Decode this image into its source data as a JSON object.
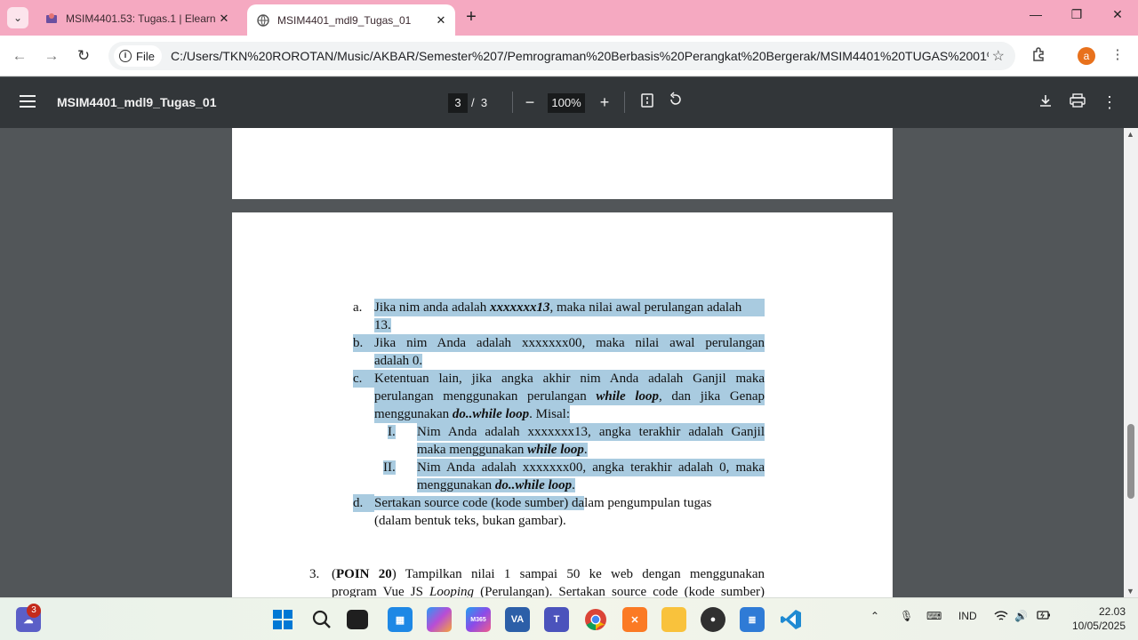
{
  "browser": {
    "tabs": [
      {
        "title": "MSIM4401.53: Tugas.1 | Elearni",
        "active": false
      },
      {
        "title": "MSIM4401_mdl9_Tugas_01",
        "active": true
      }
    ],
    "address": {
      "chip_label": "File",
      "url": "C:/Users/TKN%20ROROTAN/Music/AKBAR/Semester%207/Pemrograman%20Berbasis%20Perangkat%20Bergerak/MSIM4401%20TUGAS%2001%2..."
    },
    "profile_initial": "a"
  },
  "pdf_toolbar": {
    "title": "MSIM4401_mdl9_Tugas_01",
    "current_page": "3",
    "page_separator": "/",
    "total_pages": "3",
    "zoom": "100%"
  },
  "document": {
    "items": {
      "a_marker": "a.",
      "a_l1_pre": "Jika nim anda adalah ",
      "a_l1_em": "xxxxxxx13",
      "a_l1_post": ", maka nilai awal perulangan adalah",
      "a_l2": "13.",
      "b_marker": "b.",
      "b_l1": "Jika nim Anda adalah xxxxxxx00, maka nilai awal perulangan",
      "b_l2": "adalah 0.",
      "c_marker": "c.",
      "c_l1": "Ketentuan lain, jika angka akhir nim Anda adalah Ganjil maka",
      "c_l2_pre": "perulangan menggunakan perulangan ",
      "c_l2_em": "while loop",
      "c_l2_post": ", dan jika Genap",
      "c_l3_pre": "menggunakan ",
      "c_l3_em": "do..while loop",
      "c_l3_post": ". Misal:",
      "i_marker": "I.",
      "i_l1": "Nim Anda adalah xxxxxxx13, angka terakhir adalah Ganjil",
      "i_l2_pre": "maka menggunakan ",
      "i_l2_em": "while loop",
      "i_l2_post": ".",
      "ii_marker": "II.",
      "ii_l1": "Nim Anda adalah xxxxxxx00, angka terakhir adalah 0, maka",
      "ii_l2_pre": "menggunakan ",
      "ii_l2_em": "do..while loop",
      "ii_l2_post": ".",
      "d_marker": "d.",
      "d_l1_hl": "Sertakan source code (kode sumber) da",
      "d_l1_rest": "lam pengumpulan tugas",
      "d_l2": "(dalam bentuk teks, bukan gambar).",
      "n3_marker": "3.",
      "n3_l1_open": "(",
      "n3_l1_bold": "POIN 20",
      "n3_l1_rest": ") Tampilkan nilai 1 sampai 50 ke web dengan menggunakan",
      "n3_l2_pre": "program Vue JS ",
      "n3_l2_em": "Looping",
      "n3_l2_post": " (Perulangan). Sertakan source code (kode sumber)"
    }
  },
  "taskbar": {
    "notification_count": "3",
    "apps": [
      "widgets",
      "start",
      "search",
      "file-explorer-dark",
      "microsoft-store",
      "copilot",
      "m365",
      "visual-studio",
      "teams",
      "chrome",
      "xampp",
      "file-explorer",
      "obs",
      "notepad",
      "vscode"
    ],
    "language": "IND",
    "time": "22.03",
    "date": "10/05/2025"
  },
  "colors": {
    "tabstrip": "#f5a9c1",
    "pdf_toolbar": "#323639",
    "viewer_bg": "#525659",
    "highlight": "#a9cbe0"
  }
}
